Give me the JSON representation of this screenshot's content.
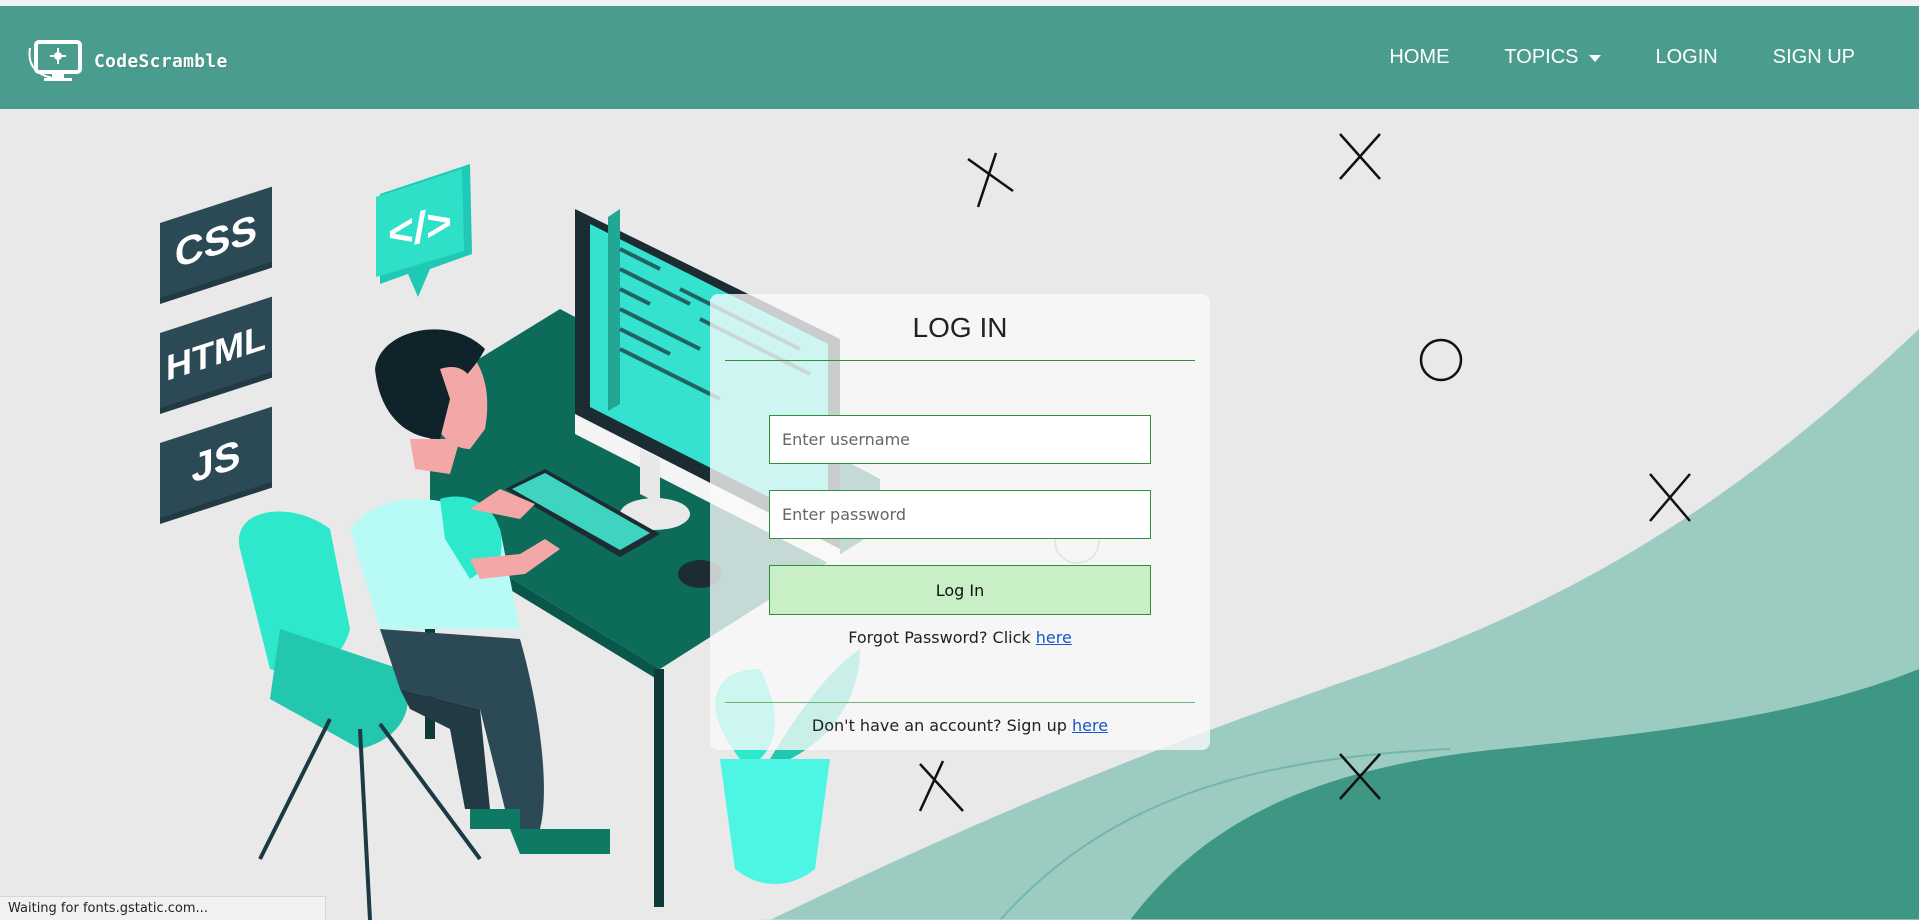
{
  "brand": {
    "name": "CodeScramble"
  },
  "nav": {
    "home": "HOME",
    "topics": "TOPICS",
    "login": "LOGIN",
    "signup": "SIGN UP"
  },
  "illustration": {
    "badges": [
      "CSS",
      "HTML",
      "JS"
    ],
    "code_bubble": "</>"
  },
  "login": {
    "title": "LOG IN",
    "username_placeholder": "Enter username",
    "password_placeholder": "Enter password",
    "button_label": "Log In",
    "forgot_prefix": "Forgot Password? Click ",
    "forgot_link": "here",
    "signup_prefix": "Don't have an account? Sign up ",
    "signup_link": "here"
  },
  "status_bar": {
    "text": "Waiting for fonts.gstatic.com..."
  },
  "colors": {
    "navbar": "#4a9d8e",
    "accent_green": "#2f8f3a",
    "button_bg": "#c9efc7",
    "teal_light": "#9ccbc2",
    "teal_dark": "#3e9784",
    "link": "#1a56c9"
  }
}
